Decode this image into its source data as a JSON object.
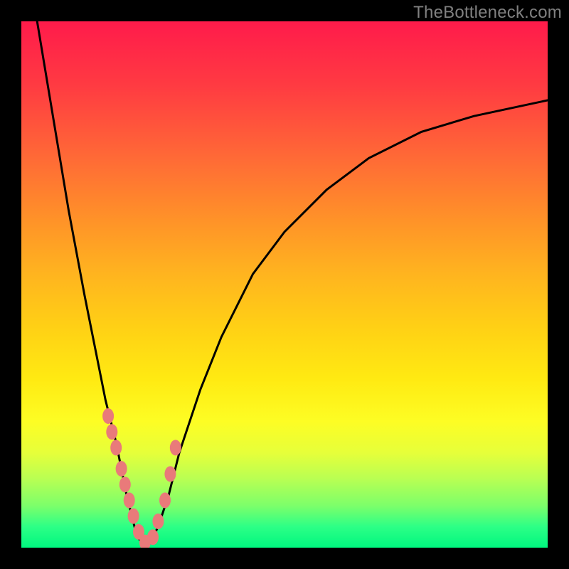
{
  "watermark": "TheBottleneck.com",
  "colors": {
    "frame": "#000000",
    "curve_stroke": "#000000",
    "dot_fill": "#e97a7a",
    "gradient_top": "#ff1b4b",
    "gradient_bottom": "#00f77f"
  },
  "chart_data": {
    "type": "line",
    "title": "",
    "xlabel": "",
    "ylabel": "",
    "xlim": [
      0,
      100
    ],
    "ylim": [
      0,
      100
    ],
    "grid": false,
    "legend": "none",
    "note": "Bottleneck-style V curve. y≈0 is optimal (green); y→100 worst (red). Curve minimum near x≈22. Tick labels not shown; values estimated from pixel geometry.",
    "series": [
      {
        "name": "bottleneck_curve",
        "x": [
          3,
          6,
          9,
          12,
          14,
          16,
          18,
          20,
          22,
          24,
          26,
          28,
          30,
          34,
          38,
          44,
          50,
          58,
          66,
          76,
          86,
          100
        ],
        "y": [
          100,
          82,
          64,
          48,
          38,
          28,
          20,
          10,
          2,
          0,
          4,
          10,
          18,
          30,
          40,
          52,
          60,
          68,
          74,
          79,
          82,
          85
        ]
      },
      {
        "name": "highlight_dots",
        "x": [
          16.5,
          17.2,
          18.0,
          19.0,
          19.7,
          20.5,
          21.3,
          22.3,
          23.5,
          25.0,
          26.0,
          27.3,
          28.3,
          29.3
        ],
        "y": [
          25,
          22,
          19,
          15,
          12,
          9,
          6,
          3,
          1,
          2,
          5,
          9,
          14,
          19
        ]
      }
    ]
  }
}
